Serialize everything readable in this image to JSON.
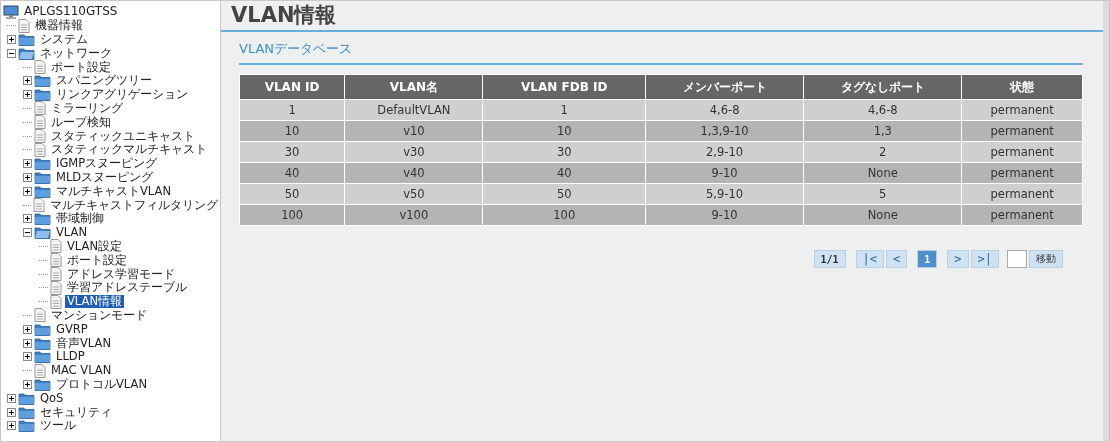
{
  "tree": {
    "label": "APLGS110GTSS",
    "kind": "device",
    "selected": false,
    "children": [
      {
        "label": "機器情報",
        "kind": "page",
        "selected": false
      },
      {
        "label": "システム",
        "kind": "folder",
        "expanded": false,
        "selected": false
      },
      {
        "label": "ネットワーク",
        "kind": "folder",
        "expanded": true,
        "selected": false,
        "children": [
          {
            "label": "ポート設定",
            "kind": "page",
            "selected": false
          },
          {
            "label": "スパニングツリー",
            "kind": "folder",
            "expanded": false,
            "selected": false
          },
          {
            "label": "リンクアグリゲーション",
            "kind": "folder",
            "expanded": false,
            "selected": false
          },
          {
            "label": "ミラーリング",
            "kind": "page",
            "selected": false
          },
          {
            "label": "ループ検知",
            "kind": "page",
            "selected": false
          },
          {
            "label": "スタティックユニキャスト",
            "kind": "page",
            "selected": false
          },
          {
            "label": "スタティックマルチキャスト",
            "kind": "page",
            "selected": false
          },
          {
            "label": "IGMPスヌーピング",
            "kind": "folder",
            "expanded": false,
            "selected": false
          },
          {
            "label": "MLDスヌーピング",
            "kind": "folder",
            "expanded": false,
            "selected": false
          },
          {
            "label": "マルチキャストVLAN",
            "kind": "folder",
            "expanded": false,
            "selected": false
          },
          {
            "label": "マルチキャストフィルタリング",
            "kind": "page",
            "selected": false
          },
          {
            "label": "帯域制御",
            "kind": "folder",
            "expanded": false,
            "selected": false
          },
          {
            "label": "VLAN",
            "kind": "folder",
            "expanded": true,
            "selected": false,
            "children": [
              {
                "label": "VLAN設定",
                "kind": "page",
                "selected": false
              },
              {
                "label": "ポート設定",
                "kind": "page",
                "selected": false
              },
              {
                "label": "アドレス学習モード",
                "kind": "page",
                "selected": false
              },
              {
                "label": "学習アドレステーブル",
                "kind": "page",
                "selected": false
              },
              {
                "label": "VLAN情報",
                "kind": "page",
                "selected": true
              }
            ]
          },
          {
            "label": "マンションモード",
            "kind": "page",
            "selected": false
          },
          {
            "label": "GVRP",
            "kind": "folder",
            "expanded": false,
            "selected": false
          },
          {
            "label": "音声VLAN",
            "kind": "folder",
            "expanded": false,
            "selected": false
          },
          {
            "label": "LLDP",
            "kind": "folder",
            "expanded": false,
            "selected": false
          },
          {
            "label": "MAC VLAN",
            "kind": "page",
            "selected": false
          },
          {
            "label": "プロトコルVLAN",
            "kind": "folder",
            "expanded": false,
            "selected": false
          }
        ]
      },
      {
        "label": "QoS",
        "kind": "folder",
        "expanded": false,
        "selected": false
      },
      {
        "label": "セキュリティ",
        "kind": "folder",
        "expanded": false,
        "selected": false
      },
      {
        "label": "ツール",
        "kind": "folder",
        "expanded": false,
        "selected": false
      }
    ]
  },
  "page_title": "VLAN情報",
  "section_title": "VLANデータベース",
  "table": {
    "columns": [
      "VLAN ID",
      "VLAN名",
      "VLAN FDB ID",
      "メンバーポート",
      "タグなしポート",
      "状態"
    ],
    "rows": [
      [
        "1",
        "DefaultVLAN",
        "1",
        "4,6-8",
        "4,6-8",
        "permanent"
      ],
      [
        "10",
        "v10",
        "10",
        "1,3,9-10",
        "1,3",
        "permanent"
      ],
      [
        "30",
        "v30",
        "30",
        "2,9-10",
        "2",
        "permanent"
      ],
      [
        "40",
        "v40",
        "40",
        "9-10",
        "None",
        "permanent"
      ],
      [
        "50",
        "v50",
        "50",
        "5,9-10",
        "5",
        "permanent"
      ],
      [
        "100",
        "v100",
        "100",
        "9-10",
        "None",
        "permanent"
      ]
    ]
  },
  "pager": {
    "summary": "1/1",
    "buttons": [
      {
        "label": "|<",
        "kind": "nav"
      },
      {
        "label": "<",
        "kind": "nav"
      },
      {
        "label": "1",
        "kind": "page",
        "selected": true
      },
      {
        "label": ">",
        "kind": "nav"
      },
      {
        "label": ">|",
        "kind": "nav"
      }
    ],
    "go_button": "移動"
  }
}
